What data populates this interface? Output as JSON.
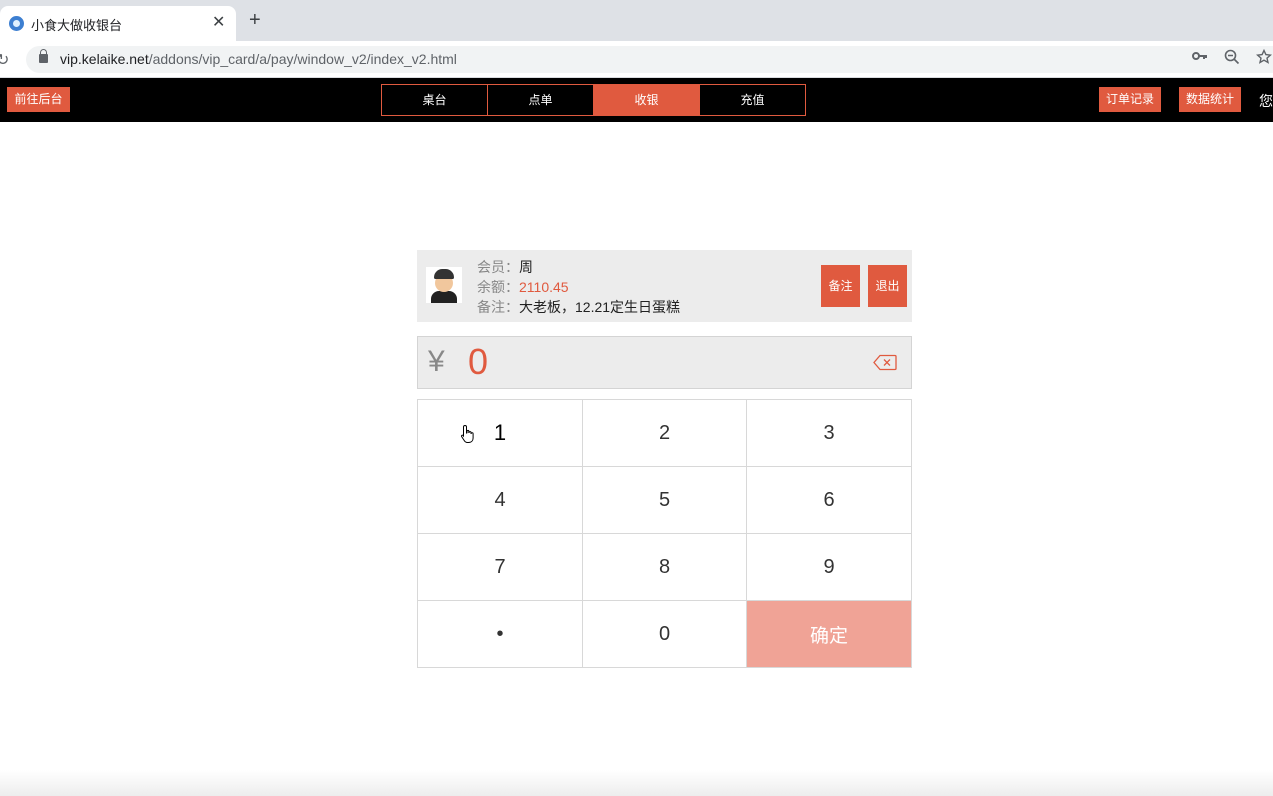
{
  "browser": {
    "tab_title": "小食大做收银台",
    "close_glyph": "✕",
    "new_tab_glyph": "+",
    "reload_glyph": "↻",
    "url_host": "vip.kelaike.net",
    "url_path": "/addons/vip_card/a/pay/window_v2/index_v2.html",
    "icons": [
      "key-icon",
      "zoom-icon",
      "star-icon"
    ]
  },
  "navbar": {
    "goto_admin": "前往后台",
    "tabs": [
      {
        "label": "桌台",
        "active": false
      },
      {
        "label": "点单",
        "active": false
      },
      {
        "label": "收银",
        "active": true
      },
      {
        "label": "充值",
        "active": false
      }
    ],
    "orders": "订单记录",
    "stats": "数据统计",
    "greeting": "您"
  },
  "member": {
    "member_label": "会员：",
    "member_name": "周",
    "balance_label": "余额：",
    "balance": "2110.45",
    "note_label": "备注：",
    "note": "大老板，12.21定生日蛋糕",
    "note_button": "备注",
    "exit_button": "退出"
  },
  "payment": {
    "currency": "¥",
    "amount": "0"
  },
  "keypad": {
    "keys": [
      "1",
      "2",
      "3",
      "4",
      "5",
      "6",
      "7",
      "8",
      "9",
      "•",
      "0",
      "确定"
    ]
  },
  "colors": {
    "accent": "#e05a3f",
    "confirm": "#f0a396",
    "navbar": "#000000"
  }
}
